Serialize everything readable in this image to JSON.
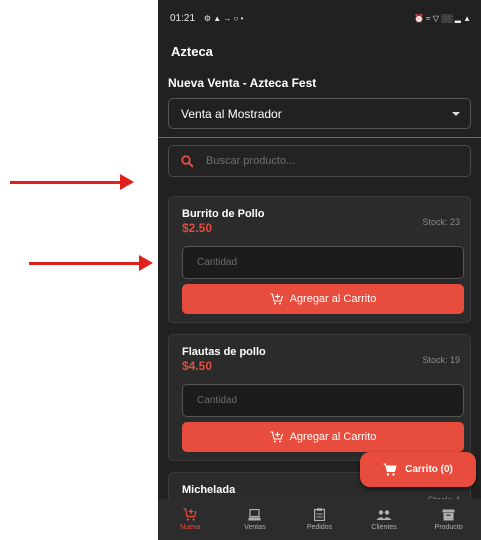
{
  "status_bar": {
    "time": "01:21",
    "left_icons": "⚙ ▲ → ○ •",
    "right_icons": "⏰ ≈ ▽ ░░ ▂ ▲"
  },
  "appbar": {
    "title": "Azteca"
  },
  "sale": {
    "header": "Nueva Venta - Azteca Fest",
    "mode_selected": "Venta al Mostrador"
  },
  "search": {
    "placeholder": "Buscar producto..."
  },
  "products": [
    {
      "name": "Burrito de Pollo",
      "price": "$2.50",
      "stock": "Stock: 23",
      "qty_placeholder": "Cantidad",
      "add_label": "Agregar al Carrito"
    },
    {
      "name": "Flautas de pollo",
      "price": "$4.50",
      "stock": "Stock: 19",
      "qty_placeholder": "Cantidad",
      "add_label": "Agregar al Carrito"
    },
    {
      "name": "Michelada",
      "stock": "Stock: 4"
    }
  ],
  "cart_button": {
    "label": "Carrito (0)"
  },
  "bottom_nav": [
    {
      "label": "Nueva",
      "icon": "cart-icon",
      "active": true
    },
    {
      "label": "Ventas",
      "icon": "register-icon"
    },
    {
      "label": "Pedidos",
      "icon": "clipboard-icon"
    },
    {
      "label": "Clientes",
      "icon": "people-icon"
    },
    {
      "label": "Producto",
      "icon": "archive-icon"
    }
  ],
  "colors": {
    "accent": "#e74c3c",
    "background": "#212121",
    "card": "#2b2b2b",
    "annotation": "#e0201a"
  }
}
